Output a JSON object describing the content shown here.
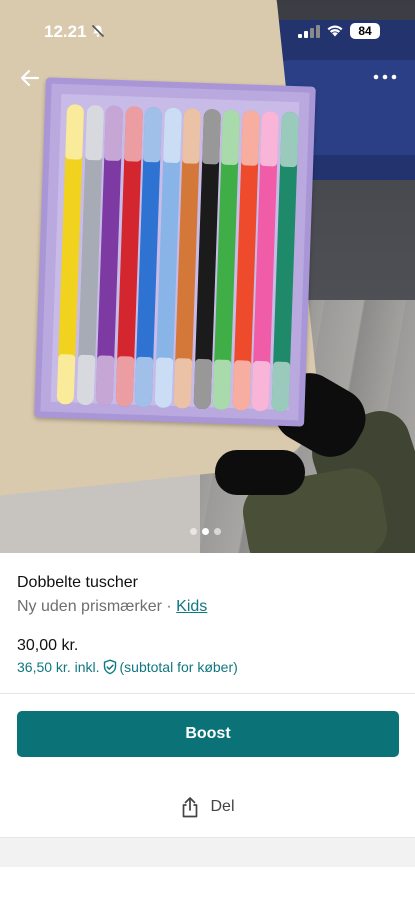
{
  "status_bar": {
    "time": "12.21",
    "battery": "84"
  },
  "photo": {
    "description_icon_back": "arrow-left-icon",
    "description_icon_more": "more-horizontal-icon",
    "carousel": {
      "total": 3,
      "active_index": 1
    },
    "marker_colors": [
      "#f1d21f",
      "#a7abb6",
      "#7e3aa3",
      "#d4262f",
      "#2e73d1",
      "#89b4e8",
      "#d4783a",
      "#1b1b1b",
      "#3fae47",
      "#ee4a2c",
      "#f05ca8",
      "#1e8a6a"
    ]
  },
  "listing": {
    "title": "Dobbelte tuscher",
    "condition": "Ny uden prismærker",
    "separator": "·",
    "category": "Kids",
    "price": "30,00 kr.",
    "price_incl": "36,50 kr. inkl.",
    "price_incl_note": "(subtotal for køber)"
  },
  "actions": {
    "boost_label": "Boost",
    "share_label": "Del"
  },
  "colors": {
    "accent": "#0b7378",
    "link": "#0f7780"
  }
}
